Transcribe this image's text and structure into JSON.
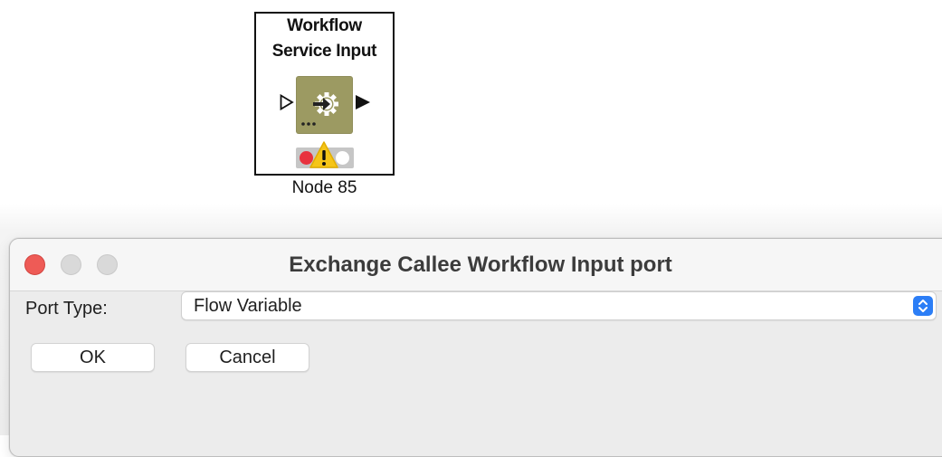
{
  "node": {
    "title_line1": "Workflow",
    "title_line2": "Service Input",
    "label": "Node 85",
    "icon": "service-input-icon",
    "status": "warning"
  },
  "dialog": {
    "title": "Exchange Callee Workflow Input port",
    "port_type_label": "Port Type:",
    "port_type_value": "Flow Variable",
    "ok_label": "OK",
    "cancel_label": "Cancel"
  },
  "colors": {
    "node_icon_bg": "#9c9a62",
    "close_button": "#ee5b56",
    "select_accent": "#2c7ef6",
    "status_red": "#e8323e",
    "warning_yellow": "#f5c518"
  }
}
